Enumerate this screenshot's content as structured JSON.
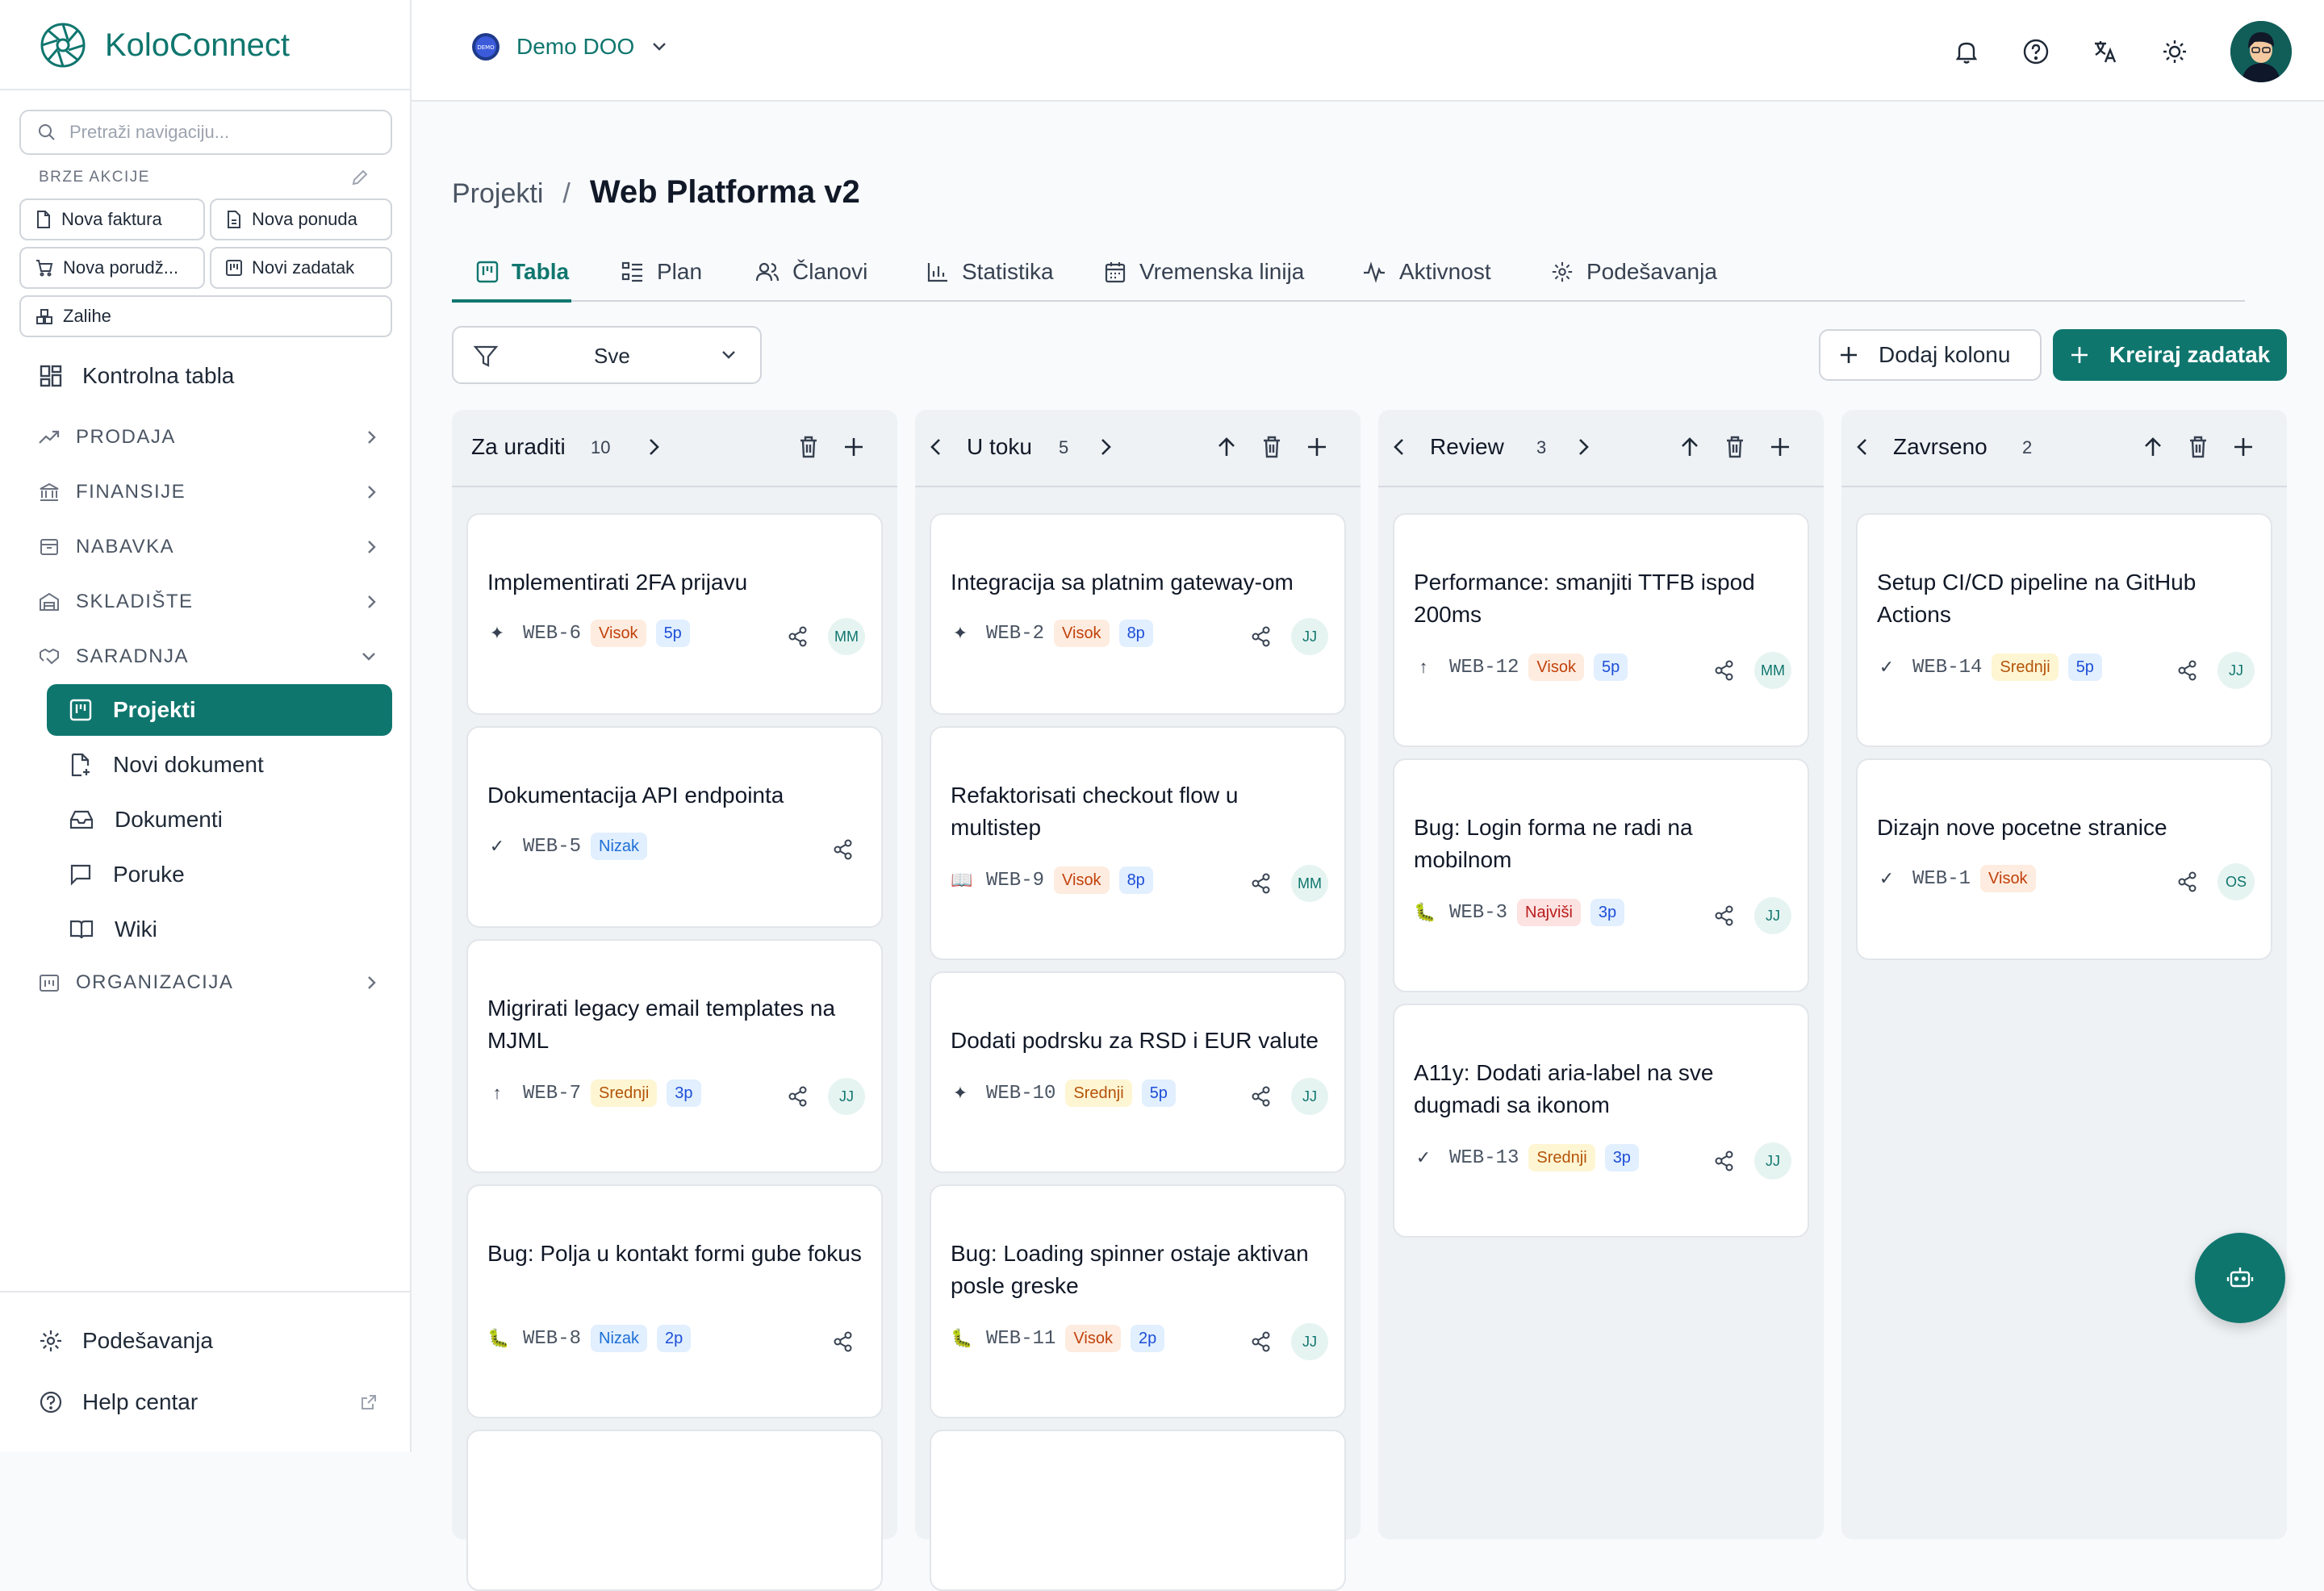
{
  "app": {
    "name": "KoloConnect"
  },
  "sidebar": {
    "search_placeholder": "Pretraži navigaciju...",
    "quick_actions_title": "BRZE AKCIJE",
    "quick_actions": [
      "Nova faktura",
      "Nova ponuda",
      "Nova porudž...",
      "Novi zadatak",
      "Zalihe"
    ],
    "dashboard": "Kontrolna tabla",
    "groups": [
      "PRODAJA",
      "FINANSIJE",
      "NABAVKA",
      "SKLADIŠTE",
      "SARADNJA",
      "ORGANIZACIJA"
    ],
    "collab_items": [
      "Projekti",
      "Novi dokument",
      "Dokumenti",
      "Poruke",
      "Wiki"
    ],
    "settings": "Podešavanja",
    "help": "Help centar"
  },
  "topbar": {
    "company": "Demo DOO",
    "company_logo_text": "DEMO"
  },
  "page": {
    "breadcrumb_parent": "Projekti",
    "breadcrumb_sep": "/",
    "title": "Web Platforma v2",
    "tabs": [
      "Tabla",
      "Plan",
      "Članovi",
      "Statistika",
      "Vremenska linija",
      "Aktivnost",
      "Podešavanja"
    ],
    "filter_value": "Sve",
    "add_column": "Dodaj kolonu",
    "create_task": "Kreiraj zadatak"
  },
  "columns": [
    {
      "title": "Za uraditi",
      "count": "10",
      "cards": [
        {
          "title": "Implementirati 2FA prijavu",
          "type_icon": "✦",
          "key": "WEB-6",
          "priority": "Visok",
          "points": "5p",
          "assignee": "MM"
        },
        {
          "title": "Dokumentacija API endpointa",
          "type_icon": "✓",
          "key": "WEB-5",
          "priority": "Nizak",
          "points": "",
          "assignee": ""
        },
        {
          "title": "Migrirati legacy email templates na MJML",
          "type_icon": "↑",
          "key": "WEB-7",
          "priority": "Srednji",
          "points": "3p",
          "assignee": "JJ"
        },
        {
          "title": "Bug: Polja u kontakt formi gube fokus",
          "type_icon": "🐛",
          "key": "WEB-8",
          "priority": "Nizak",
          "points": "2p",
          "assignee": ""
        }
      ]
    },
    {
      "title": "U toku",
      "count": "5",
      "cards": [
        {
          "title": "Integracija sa platnim gateway-om",
          "type_icon": "✦",
          "key": "WEB-2",
          "priority": "Visok",
          "points": "8p",
          "assignee": "JJ"
        },
        {
          "title": "Refaktorisati checkout flow u multistep",
          "type_icon": "📖",
          "key": "WEB-9",
          "priority": "Visok",
          "points": "8p",
          "assignee": "MM"
        },
        {
          "title": "Dodati podrsku za RSD i EUR valute",
          "type_icon": "✦",
          "key": "WEB-10",
          "priority": "Srednji",
          "points": "5p",
          "assignee": "JJ"
        },
        {
          "title": "Bug: Loading spinner ostaje aktivan posle greske",
          "type_icon": "🐛",
          "key": "WEB-11",
          "priority": "Visok",
          "points": "2p",
          "assignee": "JJ"
        }
      ]
    },
    {
      "title": "Review",
      "count": "3",
      "cards": [
        {
          "title": "Performance: smanjiti TTFB ispod 200ms",
          "type_icon": "↑",
          "key": "WEB-12",
          "priority": "Visok",
          "points": "5p",
          "assignee": "MM"
        },
        {
          "title": "Bug: Login forma ne radi na mobilnom",
          "type_icon": "🐛",
          "key": "WEB-3",
          "priority": "Najviši",
          "points": "3p",
          "assignee": "JJ"
        },
        {
          "title": "A11y: Dodati aria-label na sve dugmadi sa ikonom",
          "type_icon": "✓",
          "key": "WEB-13",
          "priority": "Srednji",
          "points": "3p",
          "assignee": "JJ"
        }
      ]
    },
    {
      "title": "Zavrseno",
      "count": "2",
      "cards": [
        {
          "title": "Setup CI/CD pipeline na GitHub Actions",
          "type_icon": "✓",
          "key": "WEB-14",
          "priority": "Srednji",
          "points": "5p",
          "assignee": "JJ"
        },
        {
          "title": "Dizajn nove pocetne stranice",
          "type_icon": "✓",
          "key": "WEB-1",
          "priority": "Visok",
          "points": "",
          "assignee": "OS"
        }
      ]
    }
  ],
  "colors": {
    "brand": "#0f766e",
    "background": "#f8fafc",
    "column": "#eef2f5"
  },
  "icons": [
    "logo-icon",
    "search-icon",
    "pencil-icon",
    "bell-icon",
    "help-icon",
    "translate-icon",
    "sun-icon",
    "bot-icon",
    "share-icon",
    "trash-icon",
    "plus-icon",
    "arrow-up-icon",
    "chevron-left-icon",
    "chevron-right-icon",
    "filter-icon"
  ]
}
